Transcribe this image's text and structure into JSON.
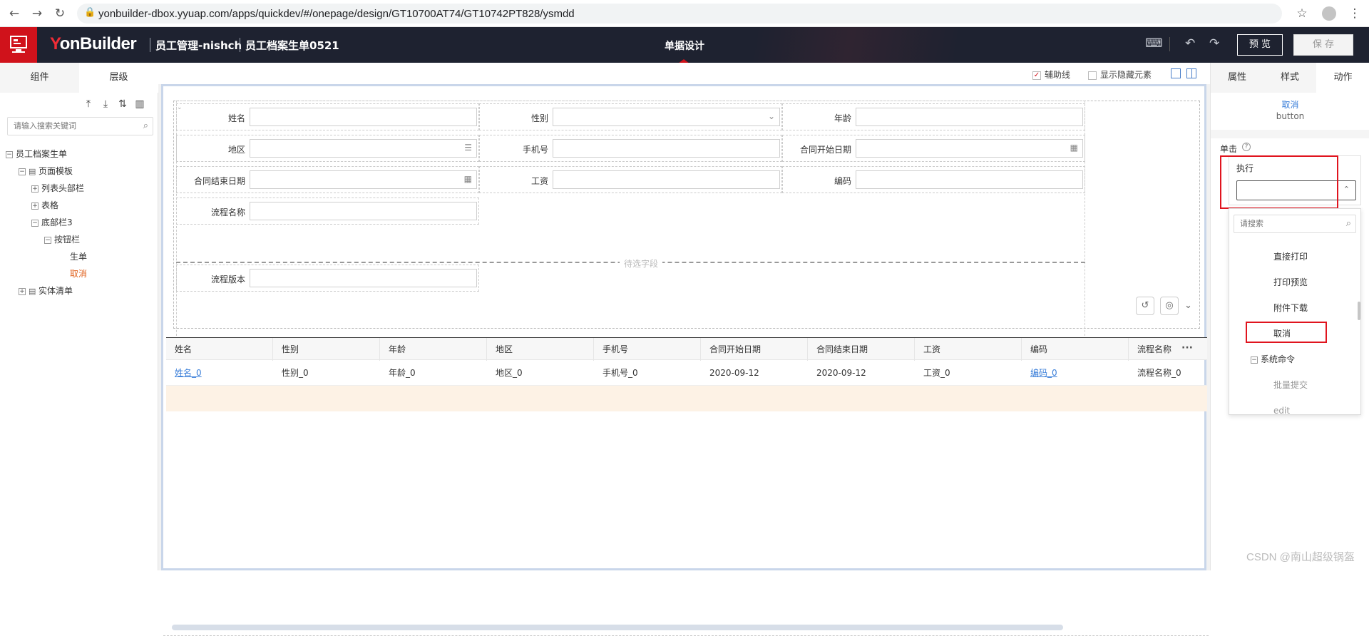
{
  "browser": {
    "url": "yonbuilder-dbox.yyuap.com/apps/quickdev/#/onepage/design/GT10700AT74/GT10742PT828/ysmdd"
  },
  "header": {
    "brand_y": "Y",
    "brand_rest": "onBuilder",
    "app_name": "员工管理-nishch",
    "doc_name": "员工档案生单0521",
    "center_title": "单据设计",
    "preview_label": "预 览",
    "save_label": "保 存"
  },
  "left_panel": {
    "tabs": [
      "组件",
      "层级"
    ],
    "active_tab": 1,
    "search_placeholder": "请输入搜索关键词",
    "tree": [
      {
        "label": "员工档案生单",
        "level": 0,
        "toggle": "−"
      },
      {
        "label": "页面模板",
        "level": 1,
        "toggle": "−"
      },
      {
        "label": "列表头部栏",
        "level": 2,
        "toggle": "+"
      },
      {
        "label": "表格",
        "level": 2,
        "toggle": "+"
      },
      {
        "label": "底部栏3",
        "level": 2,
        "toggle": "−"
      },
      {
        "label": "按钮栏",
        "level": 3,
        "toggle": "−"
      },
      {
        "label": "生单",
        "level": 4,
        "toggle": ""
      },
      {
        "label": "取消",
        "level": 4,
        "toggle": "",
        "selected": true
      },
      {
        "label": "实体清单",
        "level": 1,
        "toggle": "+"
      }
    ]
  },
  "canvas": {
    "toolbar": {
      "guide_label": "辅助线",
      "guide_checked": true,
      "hidden_label": "显示隐藏元素",
      "hidden_checked": false
    },
    "form": {
      "rows": [
        [
          {
            "label": "姓名",
            "icon": ""
          },
          {
            "label": "性别",
            "icon": "chevron"
          },
          {
            "label": "年龄",
            "icon": ""
          }
        ],
        [
          {
            "label": "地区",
            "icon": "list"
          },
          {
            "label": "手机号",
            "icon": ""
          },
          {
            "label": "合同开始日期",
            "icon": "date"
          }
        ],
        [
          {
            "label": "合同结束日期",
            "icon": "date"
          },
          {
            "label": "工资",
            "icon": ""
          },
          {
            "label": "编码",
            "icon": ""
          }
        ],
        [
          {
            "label": "流程名称",
            "icon": ""
          }
        ]
      ],
      "pending_label": "待选字段",
      "extra_row": [
        {
          "label": "流程版本",
          "icon": ""
        }
      ]
    },
    "grid": {
      "headers": [
        "姓名",
        "性别",
        "年龄",
        "地区",
        "手机号",
        "合同开始日期",
        "合同结束日期",
        "工资",
        "编码",
        "流程名称"
      ],
      "row": [
        "姓名_0",
        "性别_0",
        "年龄_0",
        "地区_0",
        "手机号_0",
        "2020-09-12",
        "2020-09-12",
        "工资_0",
        "编码_0",
        "流程名称_0"
      ],
      "link_cols": [
        0,
        8
      ],
      "more_label": "···"
    }
  },
  "right_panel": {
    "tabs": [
      "属性",
      "样式",
      "动作"
    ],
    "active_tab": 2,
    "selected_name": "取消",
    "selected_type": "button",
    "click_label": "单击",
    "exec_label": "执行",
    "exec_value": "",
    "dropdown": {
      "search_placeholder": "请搜索",
      "items": [
        {
          "label": "直接打印",
          "indent": 1
        },
        {
          "label": "打印预览",
          "indent": 1
        },
        {
          "label": "附件下载",
          "indent": 1
        },
        {
          "label": "取消",
          "indent": 1,
          "highlight": true
        },
        {
          "label": "系统命令",
          "indent": 0,
          "toggle": "−"
        },
        {
          "label": "批量提交",
          "indent": 1,
          "muted": true
        },
        {
          "label": "edit",
          "indent": 1,
          "muted": true
        }
      ]
    }
  },
  "watermark": "CSDN @南山超级锅盔",
  "colors": {
    "brand_red": "#d0121b",
    "header_bg": "#1e2230",
    "link_blue": "#3b7fd9",
    "highlight_red": "#e0141e"
  }
}
